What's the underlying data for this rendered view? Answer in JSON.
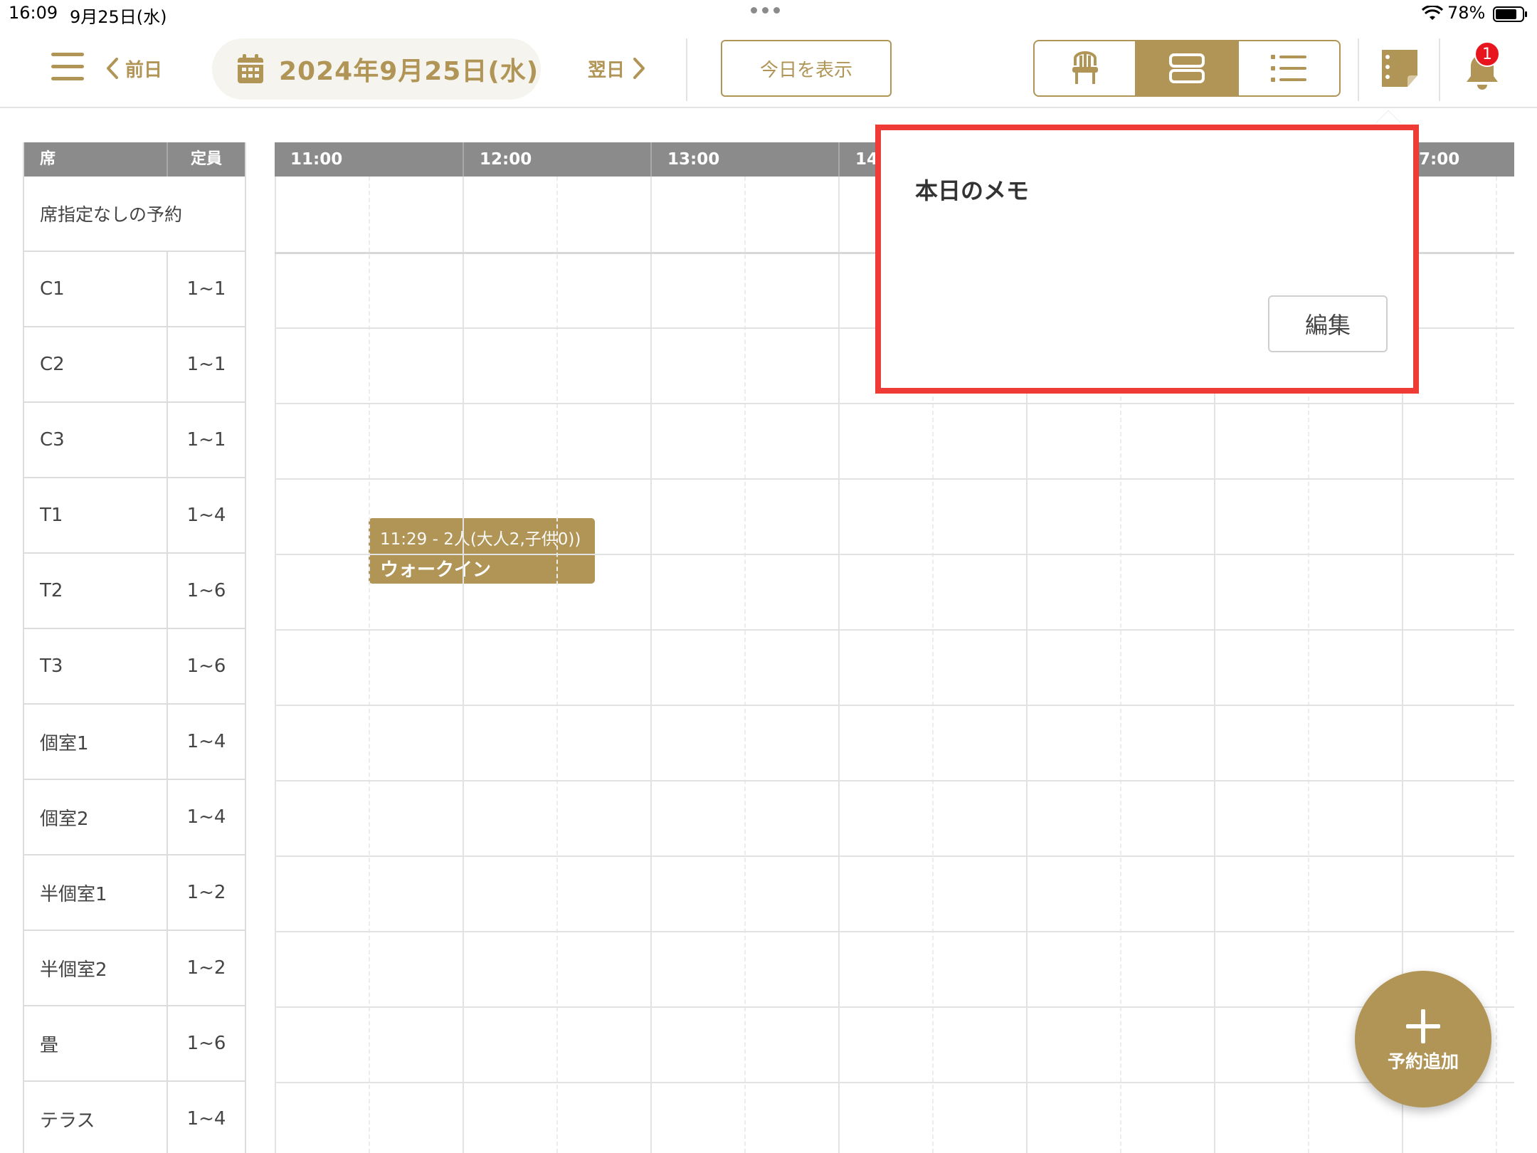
{
  "status": {
    "time": "16:09",
    "date": "9月25日(水)",
    "battery": "78%"
  },
  "toolbar": {
    "prev_label": "前日",
    "date_label": "2024年9月25日(水)",
    "next_label": "翌日",
    "today_label": "今日を表示",
    "notification_count": "1",
    "views": [
      "seat-view",
      "timeline-view",
      "list-view"
    ],
    "active_view": "timeline-view"
  },
  "seats": {
    "header_seat": "席",
    "header_capacity": "定員",
    "unassigned": "席指定なしの予約",
    "rows": [
      {
        "name": "C1",
        "cap": "1~1"
      },
      {
        "name": "C2",
        "cap": "1~1"
      },
      {
        "name": "C3",
        "cap": "1~1"
      },
      {
        "name": "T1",
        "cap": "1~4"
      },
      {
        "name": "T2",
        "cap": "1~6"
      },
      {
        "name": "T3",
        "cap": "1~6"
      },
      {
        "name": "個室1",
        "cap": "1~4"
      },
      {
        "name": "個室2",
        "cap": "1~4"
      },
      {
        "name": "半個室1",
        "cap": "1~2"
      },
      {
        "name": "半個室2",
        "cap": "1~2"
      },
      {
        "name": "畳",
        "cap": "1~6"
      },
      {
        "name": "テラス",
        "cap": "1~4"
      }
    ]
  },
  "timeline": {
    "hours": [
      "11:00",
      "12:00",
      "13:00",
      "14:",
      "",
      "",
      "7:00"
    ],
    "booking": {
      "time": "11:29 - 2人(大人2,子供0))",
      "name": "ウォークイン"
    }
  },
  "memo": {
    "title": "本日のメモ",
    "edit_label": "編集"
  },
  "fab": {
    "label": "予約追加"
  },
  "colors": {
    "accent": "#b09557",
    "header": "#8b8b8b",
    "highlight": "#ef3b35",
    "badge": "#e8141e"
  }
}
